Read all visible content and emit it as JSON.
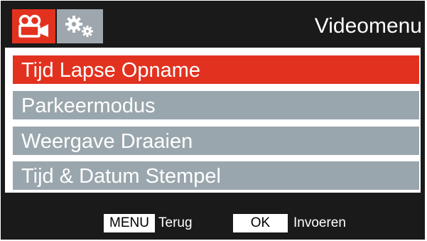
{
  "header": {
    "title": "Videomenu",
    "tabs": [
      {
        "icon": "video-camera-icon",
        "active": true
      },
      {
        "icon": "gears-icon",
        "active": false
      }
    ]
  },
  "menu": {
    "items": [
      {
        "label": "Tijd Lapse Opname",
        "selected": true
      },
      {
        "label": "Parkeermodus",
        "selected": false
      },
      {
        "label": "Weergave Draaien",
        "selected": false
      },
      {
        "label": "Tijd & Datum Stempel",
        "selected": false
      }
    ]
  },
  "footer": {
    "menu_key": "MENU",
    "menu_action": "Terug",
    "ok_key": "OK",
    "ok_action": "Invoeren"
  },
  "colors": {
    "accent": "#e2321f",
    "item_gray": "#9aa6ad",
    "background": "#1a1a1a"
  }
}
